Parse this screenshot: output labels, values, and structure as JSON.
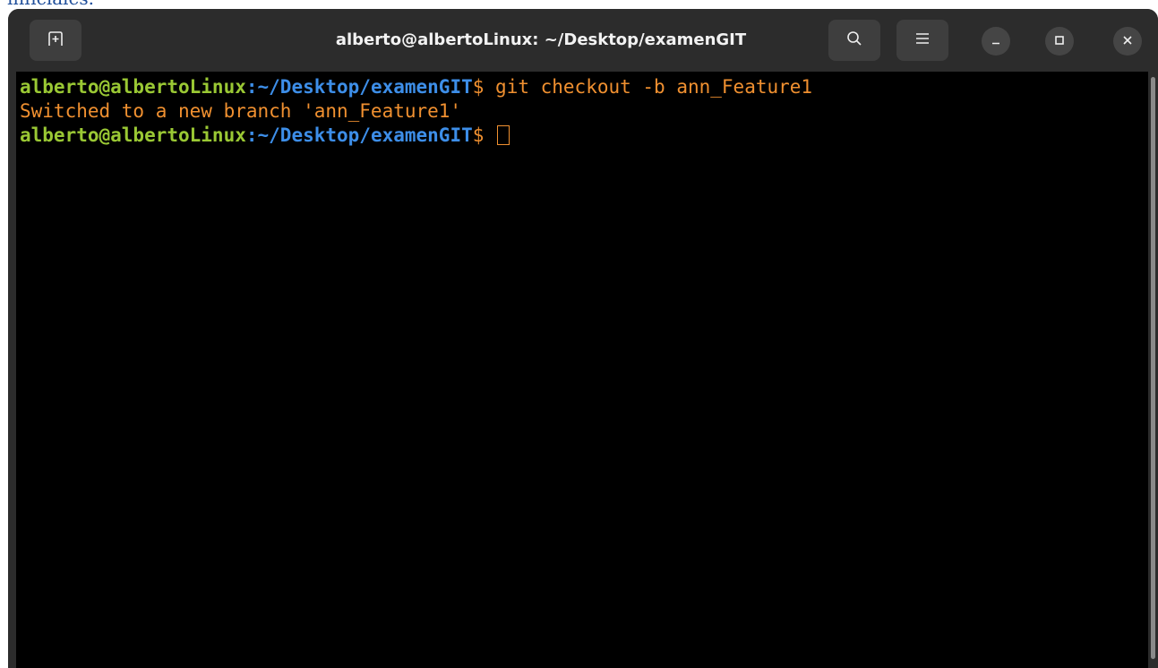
{
  "document_fragment": "inficiales.",
  "window": {
    "title": "alberto@albertoLinux: ~/Desktop/examenGIT",
    "icons": {
      "new_tab": "new-tab-icon",
      "search": "search-icon",
      "menu": "hamburger-menu-icon",
      "minimize": "minimize-icon",
      "maximize": "maximize-icon",
      "close": "close-icon"
    }
  },
  "terminal": {
    "lines": [
      {
        "user_host": "alberto@albertoLinux",
        "path": ":~/Desktop/examenGIT",
        "prompt": "$ ",
        "command": "git checkout -b ann_Feature1"
      },
      {
        "output": "Switched to a new branch 'ann_Feature1'"
      },
      {
        "user_host": "alberto@albertoLinux",
        "path": ":~/Desktop/examenGIT",
        "prompt": "$ ",
        "command": ""
      }
    ]
  },
  "colors": {
    "user_host": "#9ac834",
    "path": "#3d8ee8",
    "text": "#f09030",
    "background": "#000000",
    "headerbar": "#2c2c2c"
  }
}
